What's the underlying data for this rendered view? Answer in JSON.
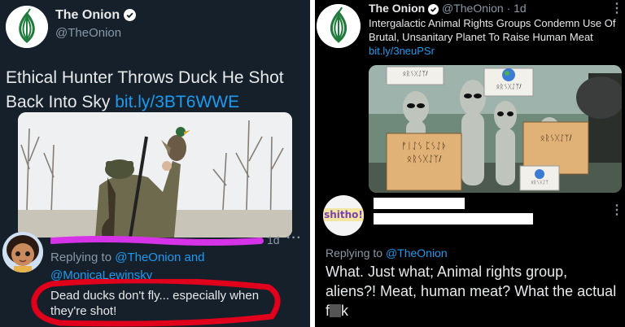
{
  "left": {
    "account": {
      "name": "The Onion",
      "handle": "@TheOnion"
    },
    "tweet": {
      "headline": "Ethical Hunter Throws Duck He Shot Back Into Sky",
      "link": "bit.ly/3BT6WWE"
    },
    "reply": {
      "time": "1d",
      "more": "···",
      "replying_prefix": "Replying to",
      "replying_to": "@TheOnion and",
      "replying_to_2": "@MonicaLewinsky",
      "text": "Dead ducks don't fly... especially when they're shot!"
    },
    "colors": {
      "bg": "#15202b",
      "link": "#1d9bf0",
      "circle": "#e0001b",
      "scribble": "#d633e8"
    }
  },
  "right": {
    "account": {
      "name": "The Onion",
      "handle": "@TheOnion",
      "time": "· 1d"
    },
    "tweet": {
      "headline": "Intergalactic Animal Rights Groups Condemn Use Of Brutal, Unsanitary Planet To Raise Human Meat",
      "link": "bit.ly/3neuPSr"
    },
    "signs": [
      "ᛟᚱᛊᚷᛇᛉ/",
      "ᛟᚱᛊᚷᛇᛉ/",
      "ᚠᛁᛇᛊ ᛈᛊᛇᚦ ᛟᚱᛊᚷᛇᛉ/",
      "ᛟᚱᛊᚷᛇᛉ/",
      "ᛟᚱᛊᚷᛇᛉ"
    ],
    "reply": {
      "avatar_text": "shitho!",
      "more": "⋮",
      "replying_prefix": "Replying to",
      "replying_to": "@TheOnion",
      "text": "What. Just what; Animal rights group, aliens?! Meat, human meat? What the actual f",
      "text_tail": "k"
    },
    "colors": {
      "bg": "#000000",
      "link": "#1d9bf0"
    }
  }
}
